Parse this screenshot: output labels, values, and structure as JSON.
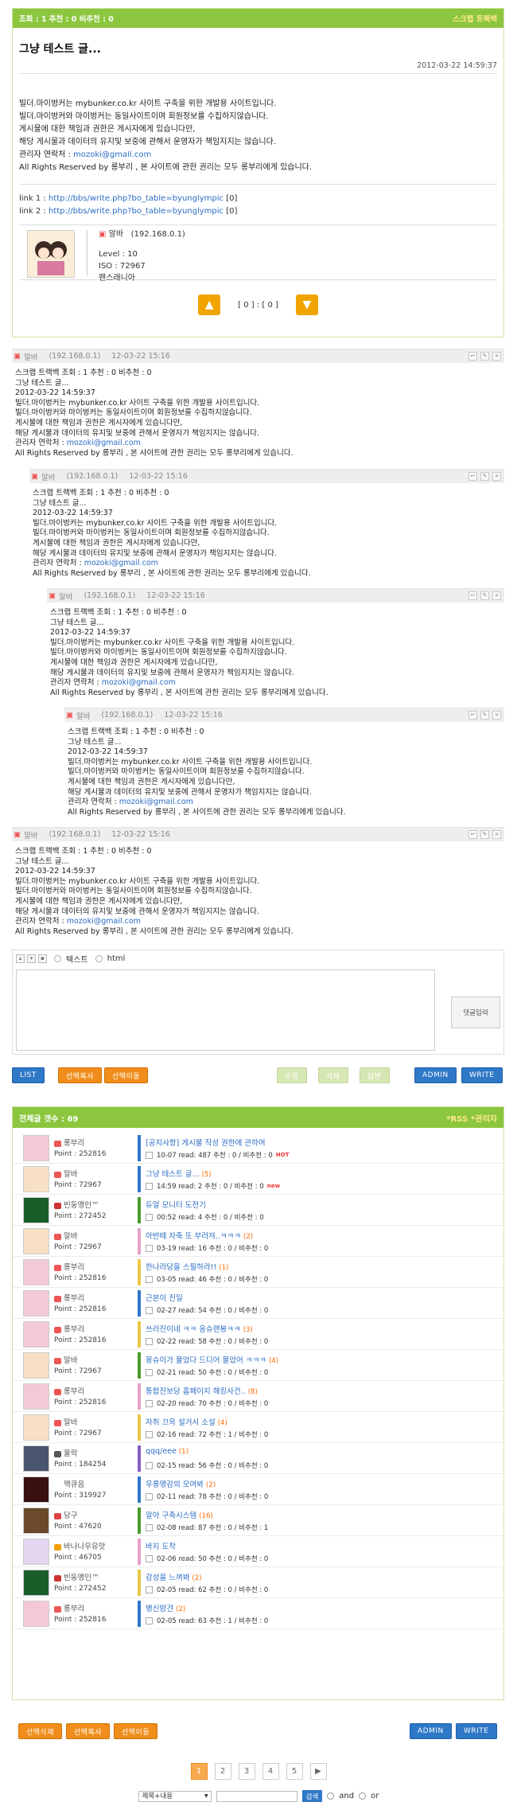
{
  "post": {
    "stats": "조회 : 1   추천 : 0 비추천 : 0",
    "scrap": "스크랩 트랙백",
    "title": "그냥 테스트 글...",
    "date": "2012-03-22 14:59:37",
    "body": [
      "빌더.마이벙커는 mybunker.co.kr 사이트 구축을 위한 개발용 사이트입니다.",
      "빌더.마이벙커와 마이벙커는 동일사이트이며 회원정보를 수집하지않습니다.",
      "게시물에 대한 책임과 권한은 게시자에게 있습니다만,",
      "해당 게시물과 데이터의 유지및 보중에 관해서 운영자가 책임지지는 않습니다."
    ],
    "admin_label": "관리자 연락처 : ",
    "admin_email": "mozoki@gmail.com",
    "rights": "All Rights Reserved by 롱부리 , 본 사이트에 관한 권리는 모두 롱부리에게 있습니다.",
    "link1_label": "link 1 : ",
    "link1": "http://bbs/write.php?bo_table=byunglympic",
    "link1_count": "[0]",
    "link2_label": "link 2 : ",
    "link2": "http://bbs/write.php?bo_table=byunglympic",
    "link2_count": "[0]",
    "author": "알바",
    "author_ip": "(192.168.0.1)",
    "level": "Level : 10",
    "iso": "ISO : 72967",
    "bio": "팬스래니아",
    "votes": "[ 0 ] : [ 0 ]"
  },
  "comment": {
    "author": "알바",
    "ip": "(192.168.0.1)",
    "date": "12-03-22 15:16",
    "lines": [
      "스크랩 트랙백 조회 : 1   추천 : 0 비추천 : 0",
      "그냥 테스트 글...",
      "2012-03-22 14:59:37",
      "빌더.마이벙커는 mybunker.co.kr 사이트 구축을 위한 개발용 사이트입니다.",
      "빌더.마이벙커와 마이벙커는 동일사이트이며 회원정보를 수집하지않습니다.",
      "게시물에 대한 책임과 권한은 게시자에게 있습니다만,",
      "해당 게시물과 데이터의 유지및 보중에 관해서 운영자가 책임지지는 않습니다."
    ],
    "admin_label": "관리자 연락처 : ",
    "admin_email": "mozoki@gmail.com",
    "rights": "All Rights Reserved by 롱부리 , 본 사이트에 관한 권리는 모두 롱부리에게 있습니다."
  },
  "editor": {
    "opt_text": "텍스트",
    "opt_html": "html",
    "submit": "댓글입력"
  },
  "buttons": {
    "list": "LIST",
    "copy": "선택복사",
    "move": "선택이동",
    "modify": "수정",
    "delete": "삭제",
    "reply": "답변",
    "admin": "ADMIN",
    "write": "WRITE",
    "del_sel": "선택삭제"
  },
  "list": {
    "count": "전체글 갯수 : 69",
    "rss": "*RSS",
    "admin": "*관리자",
    "rows": [
      {
        "nick": "롱부리",
        "point": "Point : 252816",
        "title": "[공지사항] 게시물 작성 권한에 관하여",
        "comments": "",
        "meta": "10-07 read: 487 추천 : 0 / 비추천 : 0",
        "badge": "HOT",
        "bar": "#2f78c8",
        "av": "#f3c9d5",
        "ic": "#e55"
      },
      {
        "nick": "알바",
        "point": "Point : 72967",
        "title": "그냥 테스트 글...",
        "comments": "(5)",
        "meta": "14:59 read: 2 추천 : 0 / 비추천 : 0",
        "badge": "new",
        "bar": "#2f78c8",
        "av": "#f7e0c3",
        "ic": "#e55"
      },
      {
        "nick": "빈둥맹인™",
        "point": "Point : 272452",
        "title": "듀얼 모니터 도전기",
        "comments": "",
        "meta": "00:52 read: 4 추천 : 0 / 비추천 : 0",
        "badge": "",
        "bar": "#4c9a2a",
        "av": "#1a5d2a",
        "ic": "#c33"
      },
      {
        "nick": "알바",
        "point": "Point : 72967",
        "title": "아반떼 자축 또 부러져..ㅋㅋㅋ",
        "comments": "(2)",
        "meta": "03-19 read: 16 추천 : 0 / 비추천 : 0",
        "badge": "",
        "bar": "#e5a0c8",
        "av": "#f7e0c3",
        "ic": "#e55"
      },
      {
        "nick": "롱부리",
        "point": "Point : 252816",
        "title": "한나라당을 스필하라!!",
        "comments": "(1)",
        "meta": "03-05 read: 46 추천 : 0 / 비추천 : 0",
        "badge": "",
        "bar": "#e9c84a",
        "av": "#f3c9d5",
        "ic": "#e55"
      },
      {
        "nick": "롱부리",
        "point": "Point : 252816",
        "title": "근본이 진일",
        "comments": "",
        "meta": "02-27 read: 54 추천 : 0 / 비추천 : 0",
        "badge": "",
        "bar": "#2f78c8",
        "av": "#f3c9d5",
        "ic": "#e55"
      },
      {
        "nick": "롱부리",
        "point": "Point : 252816",
        "title": "쓰러진이네 ㅋㅋ 응슈랜봉ㅋㅋ",
        "comments": "(3)",
        "meta": "02-22 read: 58 추천 : 0 / 비추천 : 0",
        "badge": "",
        "bar": "#e9c84a",
        "av": "#f3c9d5",
        "ic": "#e55"
      },
      {
        "nick": "알바",
        "point": "Point : 72967",
        "title": "몽슈이가 물었다 드디어 물었어 ㅋㅋㅋ",
        "comments": "(4)",
        "meta": "02-21 read: 50 추천 : 0 / 비추천 : 0",
        "badge": "",
        "bar": "#4c9a2a",
        "av": "#f7e0c3",
        "ic": "#e55"
      },
      {
        "nick": "롱부리",
        "point": "Point : 252816",
        "title": "통합진보당 홈페이지 해킹사건..",
        "comments": "(8)",
        "meta": "02-20 read: 70 추천 : 0 / 비추천 : 0",
        "badge": "",
        "bar": "#e5a0c8",
        "av": "#f3c9d5",
        "ic": "#e55"
      },
      {
        "nick": "알바",
        "point": "Point : 72967",
        "title": "자취 끄윽 설거시 소설",
        "comments": "(4)",
        "meta": "02-16 read: 72 추천 : 1 / 비추천 : 0",
        "badge": "",
        "bar": "#e9c84a",
        "av": "#f7e0c3",
        "ic": "#e55"
      },
      {
        "nick": "울락",
        "point": "Point : 184254",
        "title": "qqq/eee",
        "comments": "(1)",
        "meta": "02-15 read: 56 추천 : 0 / 비추천 : 0",
        "badge": "",
        "bar": "#8a5bc4",
        "av": "#4a5570",
        "ic": "#555"
      },
      {
        "nick": "맥큐음",
        "point": "Point : 319927",
        "title": "우롱맹감의 모여봐",
        "comments": "(2)",
        "meta": "02-11 read: 78 추천 : 0 / 비추천 : 0",
        "badge": "",
        "bar": "#2f78c8",
        "av": "#3a1010",
        "ic": ""
      },
      {
        "nick": "당구",
        "point": "Point : 47620",
        "title": "알아 구축시스템",
        "comments": "(16)",
        "meta": "02-08 read: 87 추천 : 0 / 비추천 : 1",
        "badge": "",
        "bar": "#4c9a2a",
        "av": "#6a4a2a",
        "ic": "#d44"
      },
      {
        "nick": "바나나우유맛",
        "point": "Point : 46705",
        "title": "바지 도착",
        "comments": "",
        "meta": "02-06 read: 50 추천 : 0 / 비추천 : 0",
        "badge": "",
        "bar": "#e5a0c8",
        "av": "#e6d5f0",
        "ic": "#f0a000"
      },
      {
        "nick": "빈둥맹인™",
        "point": "Point : 272452",
        "title": "감성을 느껴봐",
        "comments": "(2)",
        "meta": "02-05 read: 62 추천 : 0 / 비추천 : 0",
        "badge": "",
        "bar": "#e9c84a",
        "av": "#1a5d2a",
        "ic": "#c33"
      },
      {
        "nick": "롱부리",
        "point": "Point : 252816",
        "title": "병신밤견",
        "comments": "(2)",
        "meta": "02-05 read: 63 추천 : 1 / 비추천 : 0",
        "badge": "",
        "bar": "#2f78c8",
        "av": "#f3c9d5",
        "ic": "#e55"
      }
    ]
  },
  "pager": {
    "pages": [
      "1",
      "2",
      "3",
      "4",
      "5"
    ],
    "next": "▶"
  },
  "search": {
    "field": "제목+내용",
    "button": "검색",
    "and": "and",
    "or": "or"
  }
}
